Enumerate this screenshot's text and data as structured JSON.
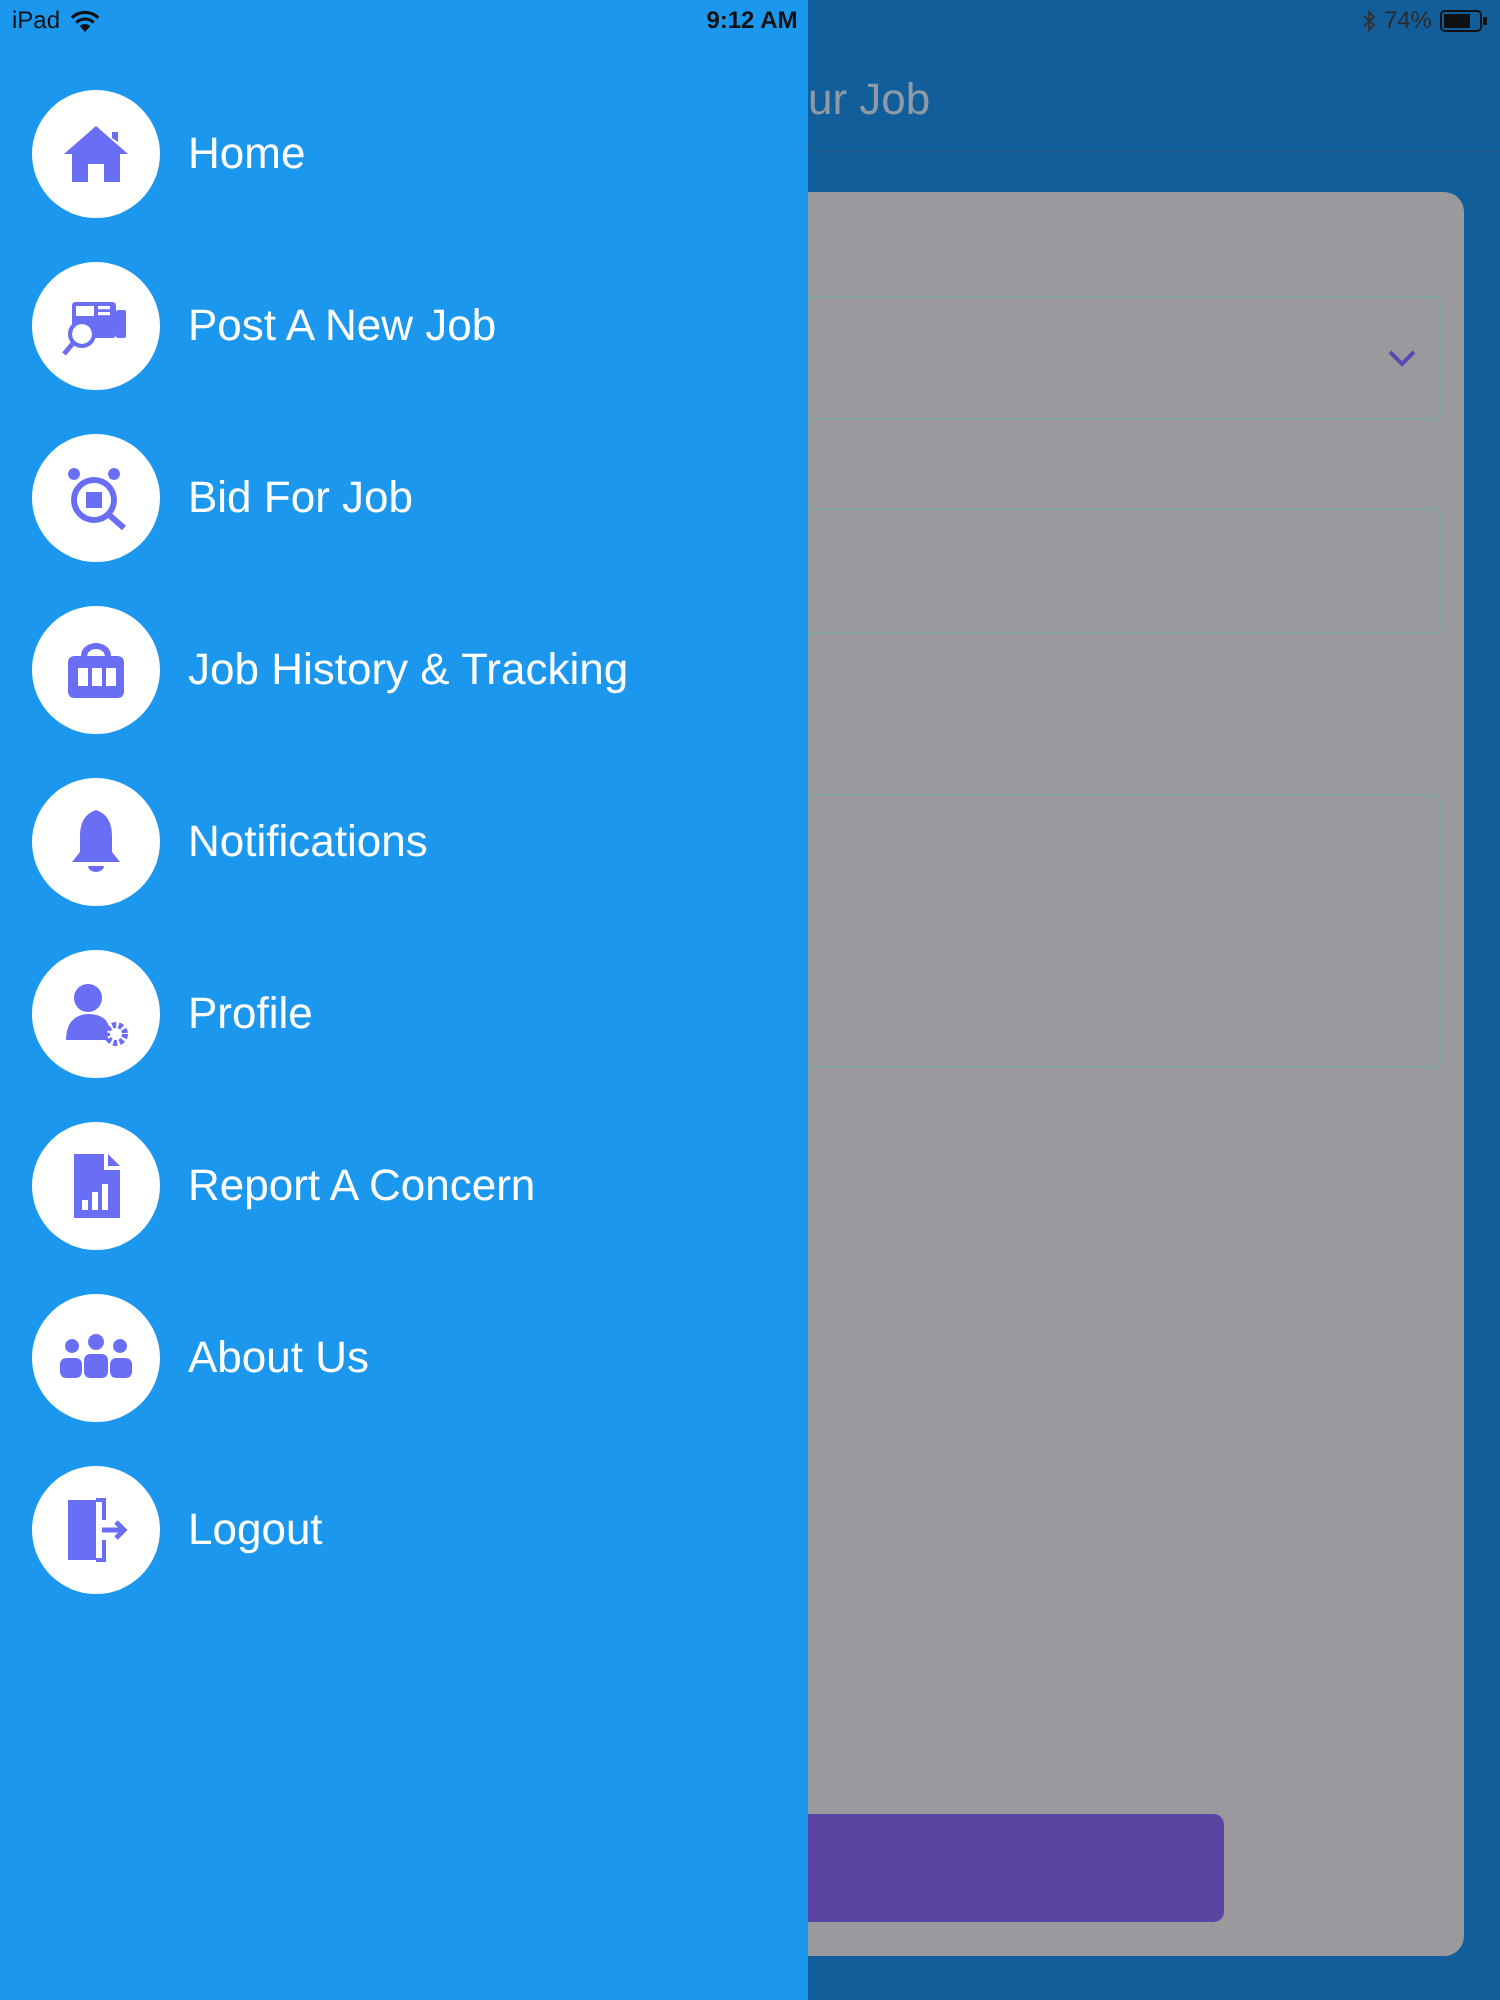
{
  "status_bar": {
    "device": "iPad",
    "time": "9:12 AM",
    "battery": "74%"
  },
  "menu": {
    "items": [
      {
        "label": "Home"
      },
      {
        "label": "Post A New Job"
      },
      {
        "label": "Bid For Job"
      },
      {
        "label": "Job History & Tracking"
      },
      {
        "label": "Notifications"
      },
      {
        "label": "Profile"
      },
      {
        "label": "Report A Concern"
      },
      {
        "label": "About Us"
      },
      {
        "label": "Logout"
      }
    ]
  },
  "background_screen": {
    "title": "ur Job"
  }
}
